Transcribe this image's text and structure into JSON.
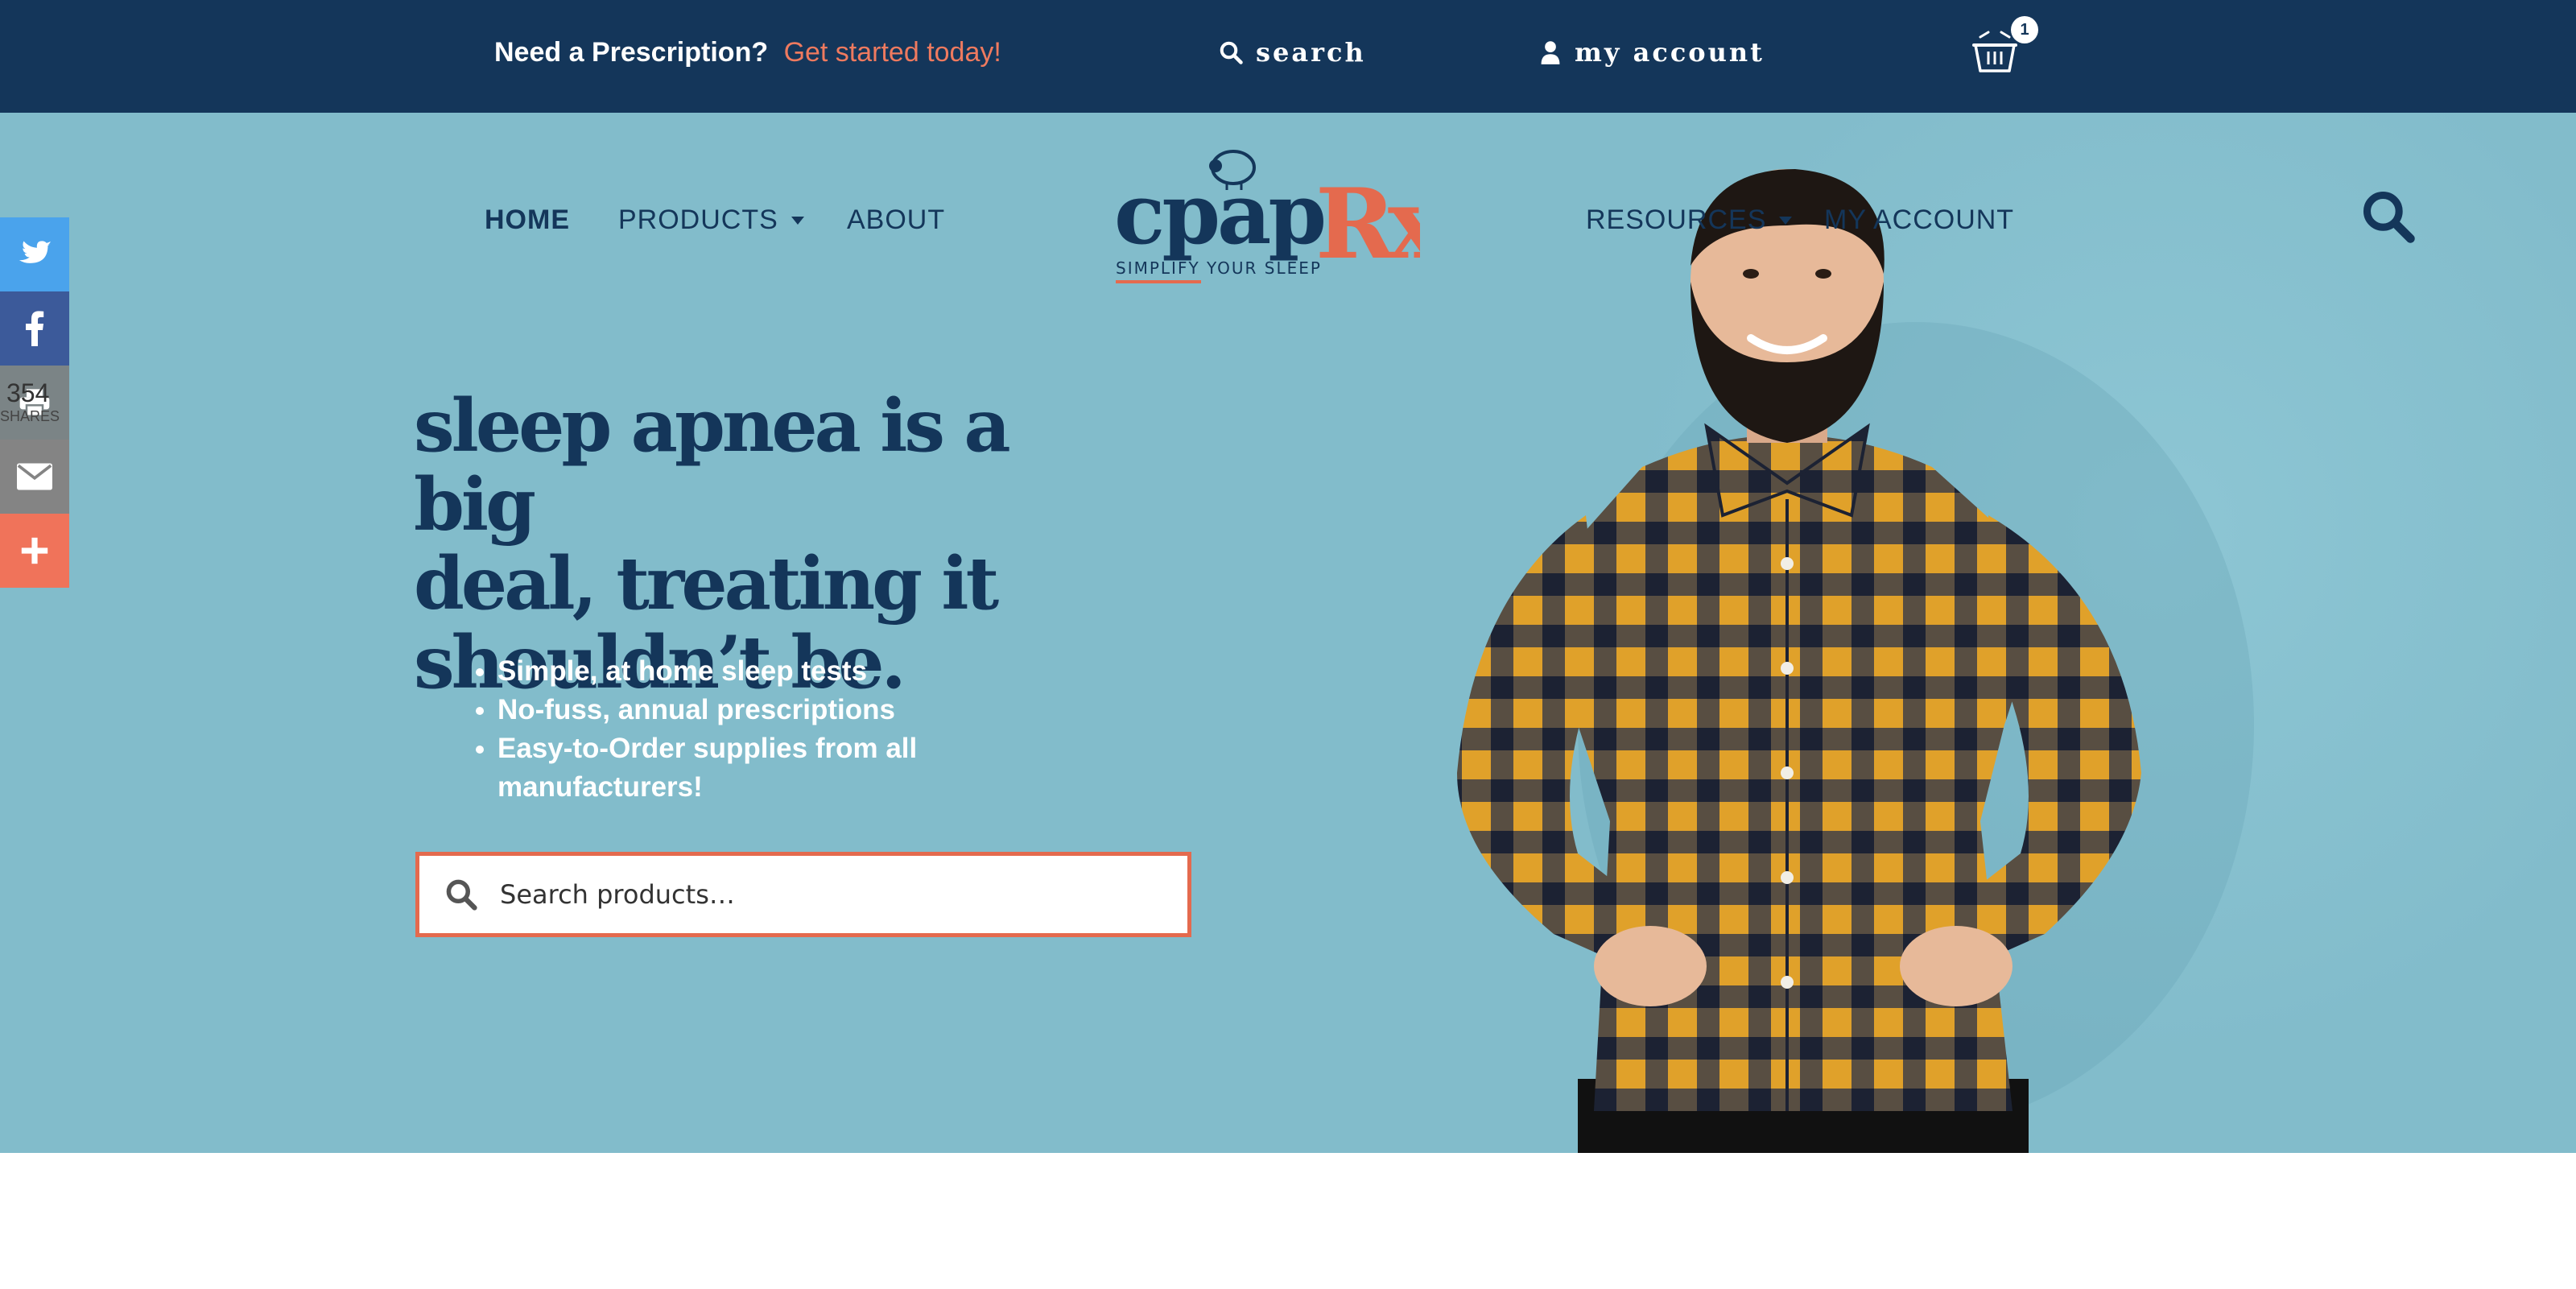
{
  "topbar": {
    "promo_text": "Need a Prescription?",
    "promo_cta": "Get started today!",
    "search_label": "search",
    "account_label": "my account",
    "cart_count": "1"
  },
  "nav": {
    "home": "HOME",
    "products": "PRODUCTS",
    "about": "ABOUT",
    "resources": "RESOURCES",
    "my_account": "MY ACCOUNT"
  },
  "logo": {
    "brand_main": "cpap",
    "brand_rx": "Rx",
    "tagline": "SIMPLIFY YOUR SLEEP"
  },
  "hero": {
    "headline_line1": "sleep apnea is a big",
    "headline_line2": "deal, treating it",
    "headline_line3": "shouldn’t be.",
    "bullets": [
      "Simple, at home sleep tests",
      "No-fuss, annual prescriptions",
      "Easy-to-Order supplies from all manufacturers!"
    ],
    "search_placeholder": "Search products…"
  },
  "share": {
    "count": "354",
    "label": "SHARES"
  },
  "colors": {
    "navy": "#14365a",
    "hero_bg": "#82bccb",
    "accent": "#e46a4e",
    "twitter": "#4aa3ec",
    "facebook": "#3c5a9a",
    "print": "#7b8486",
    "email": "#848484",
    "more": "#f0735a"
  }
}
